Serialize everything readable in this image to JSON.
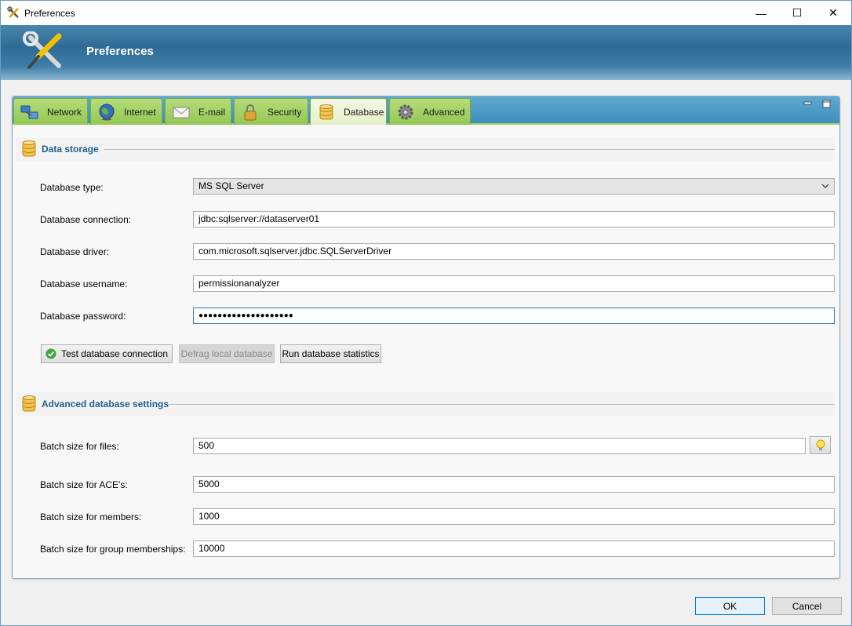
{
  "window": {
    "title": "Preferences",
    "minimize_glyph": "—",
    "maximize_glyph": "☐",
    "close_glyph": "✕"
  },
  "banner": {
    "title": "Preferences",
    "icon": "tools-icon"
  },
  "tabs": [
    {
      "label": "Network",
      "icon": "network-icon"
    },
    {
      "label": "Internet",
      "icon": "globe-icon"
    },
    {
      "label": "E-mail",
      "icon": "envelope-icon"
    },
    {
      "label": "Security",
      "icon": "padlock-icon"
    },
    {
      "label": "Database",
      "icon": "database-icon",
      "active": true
    },
    {
      "label": "Advanced",
      "icon": "gear-icon"
    }
  ],
  "data_storage": {
    "title": "Data storage",
    "type_label": "Database type:",
    "type_value": "MS SQL Server",
    "connection_label": "Database connection:",
    "connection_value": "jdbc:sqlserver://dataserver01",
    "driver_label": "Database driver:",
    "driver_value": "com.microsoft.sqlserver.jdbc.SQLServerDriver",
    "username_label": "Database username:",
    "username_value": "permissionanalyzer",
    "password_label": "Database password:",
    "password_value": "●●●●●●●●●●●●●●●●●●●●",
    "test_button": "Test database connection",
    "defrag_button": "Defrag local database",
    "stats_button": "Run database statistics"
  },
  "advanced_settings": {
    "title": "Advanced database settings",
    "files_label": "Batch size for files:",
    "files_value": "500",
    "aces_label": "Batch size for ACE's:",
    "aces_value": "5000",
    "members_label": "Batch size for members:",
    "members_value": "1000",
    "groups_label": "Batch size for group memberships:",
    "groups_value": "10000"
  },
  "dialog": {
    "ok": "OK",
    "cancel": "Cancel"
  },
  "colors": {
    "accent": "#0078d7",
    "tab_green": "#93c653",
    "section_title": "#1e5f8e",
    "banner_blue": "#2d6b96"
  }
}
